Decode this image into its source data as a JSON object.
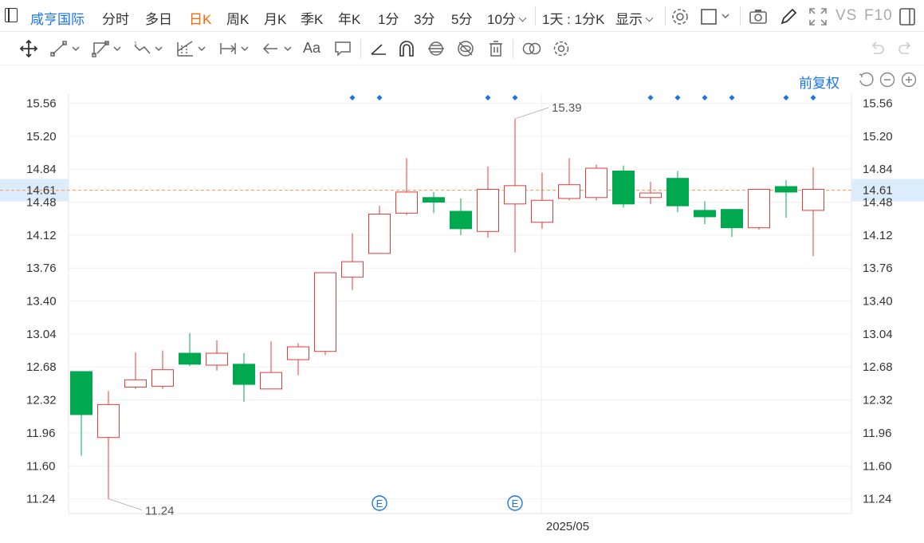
{
  "header": {
    "stock_name": "咸亨国际",
    "periods": [
      "分时",
      "多日",
      "日K",
      "周K",
      "月K",
      "季K",
      "年K",
      "1分",
      "3分",
      "5分",
      "10分"
    ],
    "active_period": "日K",
    "range_label": "1天 : 1分K",
    "display_label": "显示",
    "vs_label": "VS",
    "f10_label": "F10"
  },
  "restore_label": "前复权",
  "price_axis": {
    "ticks": [
      "15.56",
      "15.20",
      "14.84",
      "14.61",
      "14.48",
      "14.12",
      "13.76",
      "13.40",
      "13.04",
      "12.68",
      "12.32",
      "11.96",
      "11.60",
      "11.24"
    ]
  },
  "current_price": "14.61",
  "high_marker": "15.39",
  "low_marker": "11.24",
  "event_marker": "E",
  "colors": {
    "up": "#e03c3c",
    "down": "#00a84f",
    "accent": "#1a73e8",
    "current_line": "#f09a4a",
    "highlight_bg": "#dcecfb"
  },
  "chart_data": {
    "type": "candlestick",
    "x_label": "2025/05",
    "ylim": [
      11.08,
      15.66
    ],
    "current_price": 14.61,
    "candles": [
      {
        "o": 12.63,
        "c": 12.16,
        "h": 12.63,
        "l": 11.71
      },
      {
        "o": 11.91,
        "c": 12.27,
        "h": 12.42,
        "l": 11.24
      },
      {
        "o": 12.46,
        "c": 12.54,
        "h": 12.84,
        "l": 12.44
      },
      {
        "o": 12.47,
        "c": 12.65,
        "h": 12.86,
        "l": 12.44
      },
      {
        "o": 12.83,
        "c": 12.71,
        "h": 13.05,
        "l": 12.69
      },
      {
        "o": 12.7,
        "c": 12.83,
        "h": 12.97,
        "l": 12.64
      },
      {
        "o": 12.71,
        "c": 12.49,
        "h": 12.83,
        "l": 12.3
      },
      {
        "o": 12.44,
        "c": 12.62,
        "h": 12.96,
        "l": 12.44
      },
      {
        "o": 12.76,
        "c": 12.9,
        "h": 12.94,
        "l": 12.59
      },
      {
        "o": 12.85,
        "c": 13.71,
        "h": 13.71,
        "l": 12.81
      },
      {
        "o": 13.66,
        "c": 13.83,
        "h": 14.14,
        "l": 13.52
      },
      {
        "o": 13.92,
        "c": 14.35,
        "h": 14.44,
        "l": 13.92
      },
      {
        "o": 14.36,
        "c": 14.59,
        "h": 14.96,
        "l": 14.34
      },
      {
        "o": 14.53,
        "c": 14.48,
        "h": 14.59,
        "l": 14.36
      },
      {
        "o": 14.38,
        "c": 14.19,
        "h": 14.52,
        "l": 14.12
      },
      {
        "o": 14.16,
        "c": 14.62,
        "h": 14.87,
        "l": 14.09
      },
      {
        "o": 14.46,
        "c": 14.66,
        "h": 15.39,
        "l": 13.93
      },
      {
        "o": 14.26,
        "c": 14.5,
        "h": 14.8,
        "l": 14.19
      },
      {
        "o": 14.52,
        "c": 14.67,
        "h": 14.96,
        "l": 14.5
      },
      {
        "o": 14.53,
        "c": 14.85,
        "h": 14.89,
        "l": 14.5
      },
      {
        "o": 14.82,
        "c": 14.46,
        "h": 14.88,
        "l": 14.42
      },
      {
        "o": 14.53,
        "c": 14.58,
        "h": 14.7,
        "l": 14.46
      },
      {
        "o": 14.74,
        "c": 14.44,
        "h": 14.82,
        "l": 14.37
      },
      {
        "o": 14.39,
        "c": 14.32,
        "h": 14.49,
        "l": 14.24
      },
      {
        "o": 14.4,
        "c": 14.2,
        "h": 14.4,
        "l": 14.1
      },
      {
        "o": 14.2,
        "c": 14.62,
        "h": 14.62,
        "l": 14.18
      },
      {
        "o": 14.65,
        "c": 14.59,
        "h": 14.72,
        "l": 14.31
      },
      {
        "o": 14.39,
        "c": 14.62,
        "h": 14.86,
        "l": 13.89
      }
    ],
    "top_markers_at_candles": [
      10,
      11,
      15,
      16,
      21,
      22,
      23,
      24,
      26,
      27
    ],
    "event_markers_at_candles": [
      11,
      16
    ]
  }
}
